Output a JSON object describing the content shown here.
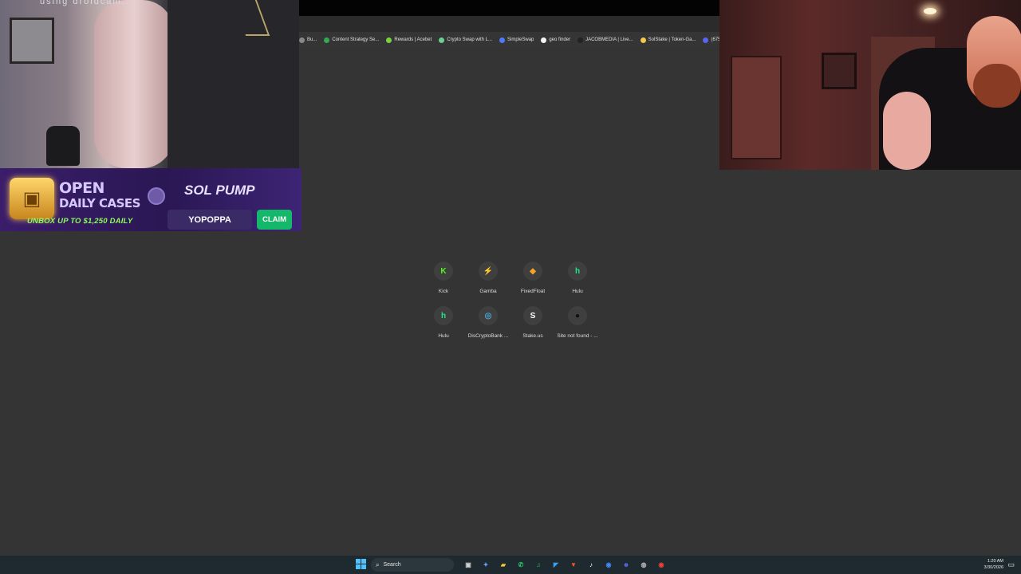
{
  "webcam_left": {
    "overlay_text": "using droidcam..."
  },
  "bookmarks": [
    {
      "label": "Bu...",
      "color": "#888888"
    },
    {
      "label": "Content Strategy Se...",
      "color": "#34a853"
    },
    {
      "label": "Rewards | Acebet",
      "color": "#7bd33b"
    },
    {
      "label": "Crypto Swap with L...",
      "color": "#6ccf91"
    },
    {
      "label": "SimpleSwap",
      "color": "#4b7bff"
    },
    {
      "label": "geo finder",
      "color": "#f5f5f5"
    },
    {
      "label": "JACOBMEDIA | Live...",
      "color": "#222222"
    },
    {
      "label": "SolStake | Token-Ga...",
      "color": "#f2c94c"
    },
    {
      "label": "(675) Disc",
      "color": "#5865f2"
    }
  ],
  "banner": {
    "headline_1": "OPEN",
    "headline_2": "DAILY CASES",
    "subline": "UNBOX UP TO $1,250 DAILY",
    "brand": "SOL PUMP",
    "promo_code": "YOPOPPA",
    "cta": "CLAIM"
  },
  "shortcuts": [
    {
      "label": "Kick",
      "glyph": "K",
      "color": "#53fc18"
    },
    {
      "label": "Gamba",
      "glyph": "⚡",
      "color": "#3ad29f"
    },
    {
      "label": "FixedFloat",
      "glyph": "◆",
      "color": "#f5a524"
    },
    {
      "label": "Hulu",
      "glyph": "h",
      "color": "#1ce783"
    },
    {
      "label": "Hulu",
      "glyph": "h",
      "color": "#1ce783"
    },
    {
      "label": "DisCryptoBank ...",
      "glyph": "◎",
      "color": "#4aa8d8"
    },
    {
      "label": "Stake.us",
      "glyph": "S",
      "color": "#ffffff"
    },
    {
      "label": "Site not found - ...",
      "glyph": "●",
      "color": "#111111"
    }
  ],
  "taskbar": {
    "search_placeholder": "Search",
    "time": "1:20 AM",
    "date": "3/30/2026",
    "apps": [
      {
        "name": "task-view-icon",
        "glyph": "▣",
        "color": "#cfcfcf"
      },
      {
        "name": "copilot-icon",
        "glyph": "✦",
        "color": "#5fa8ff"
      },
      {
        "name": "file-explorer-icon",
        "glyph": "▰",
        "color": "#f3c338"
      },
      {
        "name": "whatsapp-icon",
        "glyph": "✆",
        "color": "#25d366"
      },
      {
        "name": "spotify-icon",
        "glyph": "♫",
        "color": "#1db954"
      },
      {
        "name": "vscode-icon",
        "glyph": "◤",
        "color": "#3ea0f0"
      },
      {
        "name": "brave-icon",
        "glyph": "▼",
        "color": "#fb542b"
      },
      {
        "name": "tiktok-icon",
        "glyph": "♪",
        "color": "#ffffff"
      },
      {
        "name": "chrome-icon",
        "glyph": "◉",
        "color": "#4285f4"
      },
      {
        "name": "discord-icon",
        "glyph": "☻",
        "color": "#5865f2"
      },
      {
        "name": "obs-icon",
        "glyph": "◍",
        "color": "#bdbdbd"
      },
      {
        "name": "chrome-profile-icon",
        "glyph": "◉",
        "color": "#e94235"
      }
    ]
  }
}
